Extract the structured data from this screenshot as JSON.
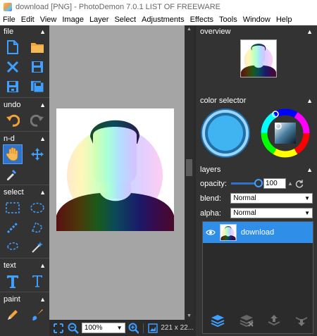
{
  "window": {
    "title": "download [PNG]  -  PhotoDemon 7.0.1  LIST OF FREEWARE"
  },
  "menu": {
    "items": [
      "File",
      "Edit",
      "View",
      "Image",
      "Layer",
      "Select",
      "Adjustments",
      "Effects",
      "Tools",
      "Window",
      "Help"
    ]
  },
  "toolbox": {
    "sections": {
      "file": "file",
      "undo": "undo",
      "nd": "n-d",
      "select": "select",
      "text": "text",
      "paint": "paint"
    },
    "tool_icons": {
      "new": "new-image-icon",
      "open": "open-folder-icon",
      "close": "close-icon",
      "save": "save-icon",
      "save_as": "save-as-icon",
      "save_all": "save-all-icon",
      "undo": "undo-icon",
      "redo": "redo-icon",
      "hand": "hand-pan-icon",
      "move": "move-icon",
      "color_picker": "color-picker-icon",
      "rect_select": "rectangle-select-icon",
      "ellipse_select": "ellipse-select-icon",
      "line_select": "line-select-icon",
      "polygon_select": "polygon-select-icon",
      "lasso_select": "lasso-select-icon",
      "magic_wand": "magic-wand-icon",
      "text": "text-icon",
      "typography": "typography-text-icon",
      "pencil": "pencil-icon",
      "brush": "paintbrush-icon"
    },
    "active_tool": "hand"
  },
  "status": {
    "zoom": "100%",
    "size": "221 x 22..."
  },
  "panels": {
    "overview": "overview",
    "color_selector": "color selector",
    "layers": "layers"
  },
  "color_selector": {
    "primary_color": "#3fb4f0",
    "wheel_marker_color": "#3fb4f0"
  },
  "layers": {
    "opacity_label": "opacity:",
    "opacity_value": "100",
    "blend_label": "blend:",
    "blend_value": "Normal",
    "alpha_label": "alpha:",
    "alpha_value": "Normal",
    "items": [
      {
        "name": "download",
        "visible": true,
        "selected": true
      }
    ]
  },
  "colors": {
    "accent": "#2f74c8",
    "selected_layer": "#2f8fe8",
    "panel_bg": "#333333",
    "canvas_bg": "#a5a5a5"
  }
}
